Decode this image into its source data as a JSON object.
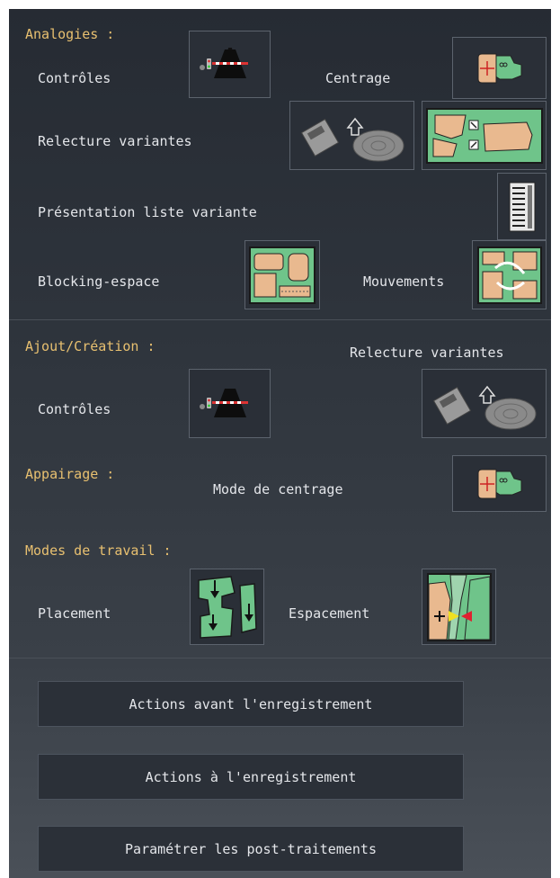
{
  "analogies": {
    "heading": "Analogies :",
    "controles": "Contrôles",
    "centrage": "Centrage",
    "relecture_variantes": "Relecture variantes",
    "presentation_liste": "Présentation liste variante",
    "blocking_espace": "Blocking-espace",
    "mouvements": "Mouvements"
  },
  "ajout": {
    "heading": "Ajout/Création :",
    "relecture_variantes": "Relecture variantes",
    "controles": "Contrôles"
  },
  "appairage": {
    "heading": "Appairage :",
    "mode_centrage": "Mode de centrage"
  },
  "modes": {
    "heading": "Modes de travail :",
    "placement": "Placement",
    "espacement": "Espacement"
  },
  "actions": {
    "avant": "Actions avant l'enregistrement",
    "pendant": "Actions à l'enregistrement",
    "post": "Paramétrer les post-traitements"
  },
  "colors": {
    "heading": "#e8c070",
    "label": "#e4e6ea",
    "map_green": "#6fc48a",
    "map_tan": "#e9b98f"
  }
}
